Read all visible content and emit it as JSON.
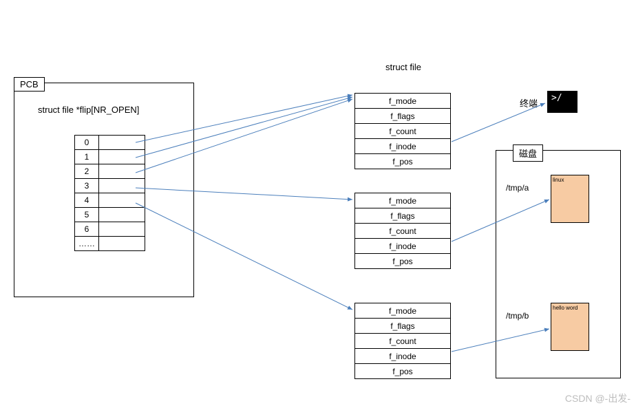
{
  "pcb": {
    "tab": "PCB",
    "caption": "struct file *flip[NR_OPEN]",
    "rows": [
      "0",
      "1",
      "2",
      "3",
      "4",
      "5",
      "6",
      "……"
    ]
  },
  "struct_file_header": "struct file",
  "struct_file_fields": [
    "f_mode",
    "f_flags",
    "f_count",
    "f_inode",
    "f_pos"
  ],
  "terminal": {
    "label": "终端",
    "prompt": ">/"
  },
  "disk": {
    "tab": "磁盘",
    "files": [
      {
        "path": "/tmp/a",
        "content": "linux"
      },
      {
        "path": "/tmp/b",
        "content": "hello word"
      }
    ]
  },
  "watermark": "CSDN @-出发-"
}
